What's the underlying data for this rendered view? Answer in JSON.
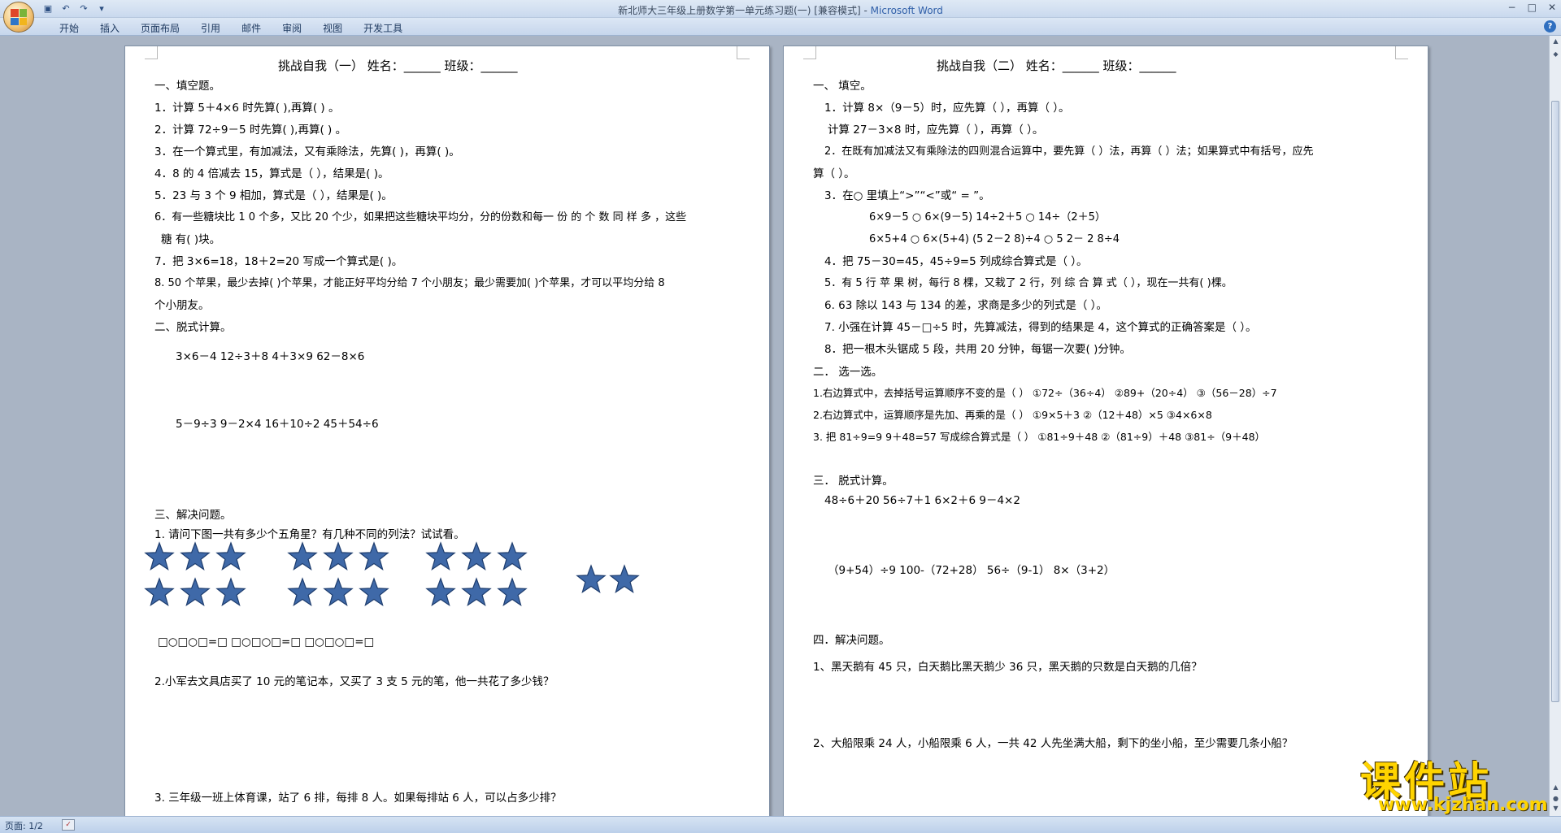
{
  "window": {
    "title": "新北师大三年级上册数学第一单元练习题(一) [兼容模式] -",
    "app_name": "Microsoft Word"
  },
  "ribbon": {
    "tabs": [
      "开始",
      "插入",
      "页面布局",
      "引用",
      "邮件",
      "审阅",
      "视图",
      "开发工具"
    ]
  },
  "page1": {
    "title": "挑战自我（一）    姓名：______    班级：______",
    "lines": [
      "一、填空题。",
      "1．计算 5＋4×6 时先算(                ),再算(                ) 。",
      "2．计算 72÷9－5 时先算(                ),再算(                ) 。",
      "3．在一个算式里，有加减法，又有乘除法，先算(            )，再算(            )。",
      "4．8 的 4 倍减去 15，算式是（                ），结果是(          )。",
      "5．23 与 3 个 9 相加，算式是（                ），结果是(          )。",
      "6．有一些糖块比 1 0 个多，又比 20 个少，如果把这些糖块平均分，分的份数和每一 份 的 个 数 同 样 多 ，这些",
      "糖 有(      )块。",
      "7．把 3×6=18，18＋2=20 写成一个算式是(                    )。",
      "8. 50 个苹果，最少去掉(       )个苹果，才能正好平均分给 7 个小朋友；最少需要加(       )个苹果，才可以平均分给 8",
      "个小朋友。",
      "二、脱式计算。",
      "3×6－4                     12÷3＋8                     4＋3×9                     62－8×6",
      "5－9÷3                     9－2×4                     16＋10÷2                     45＋54÷6",
      "三、解决问题。",
      "1. 请问下图一共有多少个五角星？有几种不同的列法？试试看。",
      "□○□○□=□      □○□○□=□      □○□○□=□",
      "2.小军去文具店买了 10 元的笔记本，又买了 3 支 5 元的笔，他一共花了多少钱？",
      "3. 三年级一班上体育课，站了 6 排，每排 8 人。如果每排站 6 人，可以占多少排？"
    ]
  },
  "page2": {
    "title": "挑战自我（二）    姓名：______    班级：______",
    "lines": [
      "一、 填空。",
      "1．计算 8×（9－5）时，应先算（              ），再算（                ）。",
      "计算 27－3×8 时，应先算（              ），再算（              ）。",
      "2．在既有加减法又有乘除法的四则混合运算中，要先算（        ）法，再算（        ）法；如果算式中有括号，应先",
      "算（            ）。",
      "3．在○ 里填上“>”“<”或“ = ”。",
      "6×9－5 ○ 6×(9－5)                  14÷2＋5 ○ 14÷（2＋5）",
      "6×5+4 ○ 6×(5+4)                   (5 2－2 8)÷4 ○ 5 2－ 2 8÷4",
      "4．把 75－30=45，45÷9=5 列成综合算式是（                ）。",
      "5．有 5 行 苹 果 树，每行 8 棵，又栽了 2 行，列 综 合 算 式（                ），现在一共有(       )棵。",
      "6.  63 除以 143 与 134 的差，求商是多少的列式是（                ）。",
      "7. 小强在计算 45－□÷5 时，先算减法，得到的结果是 4，这个算式的正确答案是（              ）。",
      "8．把一根木头锯成 5 段，共用 20 分钟，每锯一次要(    )分钟。",
      "二． 选一选。",
      "1.右边算式中，去掉括号运算顺序不变的是（      ）   ①72÷（36÷4）    ②89+（20÷4）       ③（56－28）÷7",
      "2.右边算式中，运算顺序是先加、再乘的是（      ）    ①9×5＋3          ②（12＋48）×5          ③4×6×8",
      "3. 把 81÷9=9     9＋48=57 写成综合算式是（      ）  ①81÷9＋48        ②（81÷9）＋48       ③81÷（9＋48）",
      "三． 脱式计算。",
      "48÷6＋20                      56÷7＋1                       6×2＋6                             9－4×2",
      "（9+54）÷9                  100-（72+28）              56÷（9-1）                        8×（3+2）",
      "四．解决问题。",
      "1、黑天鹅有 45 只，白天鹅比黑天鹅少 36 只，黑天鹅的只数是白天鹅的几倍？",
      "2、大船限乘 24 人，小船限乘 6 人，一共 42 人先坐满大船，剩下的坐小船，至少需要几条小船？"
    ]
  },
  "statusbar": {
    "page_info": "页面: 1/2"
  },
  "watermark": {
    "brand": "课件站",
    "url": "www.kjzhan.com"
  },
  "colors": {
    "star_fill": "#3f69a8",
    "star_stroke": "#1e3d6e",
    "title_bar": "#dfe9f5",
    "watermark": "#ffd400"
  }
}
